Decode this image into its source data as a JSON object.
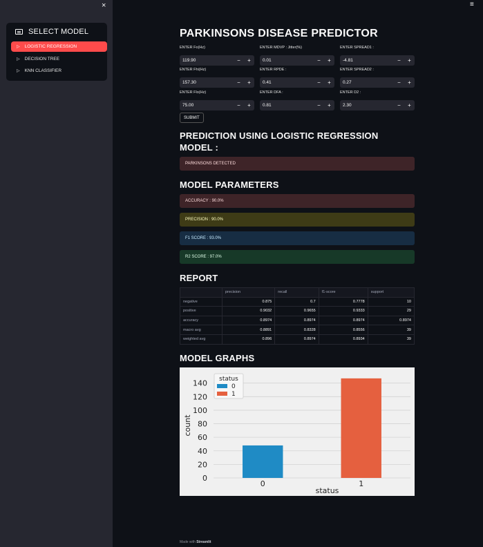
{
  "sidebar": {
    "close_glyph": "×",
    "menu_title": "SELECT MODEL",
    "items": [
      {
        "label": "LOGISTIC REGRESSION",
        "active": true
      },
      {
        "label": "DECISION TREE",
        "active": false
      },
      {
        "label": "KNN CLASSIFIER",
        "active": false
      }
    ]
  },
  "header": {
    "hamburger_glyph": "≡"
  },
  "main": {
    "title": "PARKINSONS DISEASE PREDICTOR",
    "fields": [
      {
        "label": "ENTER Fo(Hz)",
        "value": "119.90"
      },
      {
        "label": "ENTER MDVP : Jitter(%)",
        "value": "0.01"
      },
      {
        "label": "ENTER SPREAD1 :",
        "value": "-4.81"
      },
      {
        "label": "ENTER Fhi(Hz)",
        "value": "157.30"
      },
      {
        "label": "ENTER RPDE :",
        "value": "0.41"
      },
      {
        "label": "ENTER SPREAD2 :",
        "value": "0.27"
      },
      {
        "label": "ENTER Flo(Hz)",
        "value": "75.00"
      },
      {
        "label": "ENTER DFA :",
        "value": "0.81"
      },
      {
        "label": "ENTER D2 :",
        "value": "2.30"
      }
    ],
    "stepper": {
      "minus": "−",
      "plus": "+"
    },
    "submit_label": "SUBMIT",
    "prediction_heading_line1": "PREDICTION USING LOGISTIC REGRESSION",
    "prediction_heading_line2": "MODEL :",
    "prediction_result": "PARKINSONS DETECTED",
    "params_heading": "MODEL PARAMETERS",
    "accuracy": "ACCURACY : 90.0%",
    "precision": "PRECISION : 90.0%",
    "f1": "F1 SCORE : 93.0%",
    "r2": "R2 SCORE : 97.0%",
    "report_heading": "REPORT",
    "graphs_heading": "MODEL GRAPHS"
  },
  "report": {
    "columns": [
      "",
      "precision",
      "recall",
      "f1-score",
      "support"
    ],
    "rows": [
      [
        "negative",
        "0.875",
        "0.7",
        "0.7778",
        "10"
      ],
      [
        "positive",
        "0.9032",
        "0.9655",
        "0.9333",
        "29"
      ],
      [
        "accuracy",
        "0.8974",
        "0.8974",
        "0.8974",
        "0.8974"
      ],
      [
        "macro avg",
        "0.8891",
        "0.8328",
        "0.8556",
        "39"
      ],
      [
        "weighted avg",
        "0.896",
        "0.8974",
        "0.8934",
        "39"
      ]
    ]
  },
  "chart_data": {
    "type": "bar",
    "categories": [
      "0",
      "1"
    ],
    "values": [
      48,
      147
    ],
    "colors": [
      "#1f8bc5",
      "#e5603f"
    ],
    "xlabel": "status",
    "ylabel": "count",
    "yticks": [
      0,
      20,
      40,
      60,
      80,
      100,
      120,
      140
    ],
    "ylim": [
      0,
      155
    ],
    "grid": true,
    "legend": {
      "title": "status",
      "entries": [
        "0",
        "1"
      ],
      "placement": "top-left"
    }
  },
  "footer": {
    "prefix": "Made with",
    "brand": "Streamlit"
  }
}
